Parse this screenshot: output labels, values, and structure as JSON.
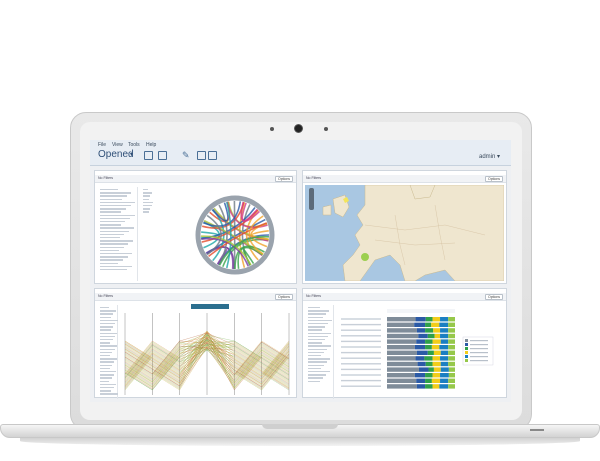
{
  "app": {
    "menu": [
      "File",
      "View",
      "Tools",
      "Help"
    ],
    "title": "Opened",
    "user": "admin"
  },
  "panels": [
    {
      "btn": "Options",
      "filter": "No Filters"
    },
    {
      "btn": "Options",
      "filter": "No Filters"
    },
    {
      "btn": "Options",
      "filter": "No Filters"
    },
    {
      "btn": "Options",
      "filter": "No Filters"
    }
  ],
  "colors": {
    "accent": "#2f4f77",
    "series": [
      "#7f8c99",
      "#2b5aa6",
      "#2fa04a",
      "#f2cd1a",
      "#1b7fc2",
      "#96c84a"
    ]
  },
  "chart_data": {
    "type": "bar",
    "stacked": true,
    "categories": [
      "",
      "",
      "",
      "",
      "",
      "",
      "",
      "",
      "",
      "",
      "",
      "",
      ""
    ],
    "series": [
      {
        "values": [
          0.42,
          0.4,
          0.44,
          0.46,
          0.43,
          0.41,
          0.44,
          0.42,
          0.45,
          0.47,
          0.41,
          0.43,
          0.44
        ]
      },
      {
        "values": [
          0.15,
          0.16,
          0.12,
          0.14,
          0.13,
          0.15,
          0.16,
          0.13,
          0.12,
          0.14,
          0.15,
          0.13,
          0.12
        ]
      },
      {
        "values": [
          0.1,
          0.09,
          0.12,
          0.1,
          0.11,
          0.1,
          0.09,
          0.12,
          0.1,
          0.08,
          0.11,
          0.1,
          0.11
        ]
      },
      {
        "values": [
          0.11,
          0.12,
          0.1,
          0.08,
          0.12,
          0.11,
          0.1,
          0.11,
          0.12,
          0.1,
          0.11,
          0.12,
          0.1
        ]
      },
      {
        "values": [
          0.12,
          0.13,
          0.12,
          0.12,
          0.11,
          0.13,
          0.11,
          0.12,
          0.11,
          0.12,
          0.13,
          0.12,
          0.13
        ]
      },
      {
        "values": [
          0.1,
          0.1,
          0.1,
          0.1,
          0.1,
          0.1,
          0.1,
          0.1,
          0.1,
          0.09,
          0.09,
          0.1,
          0.1
        ]
      }
    ],
    "xlim": [
      0,
      1
    ]
  }
}
